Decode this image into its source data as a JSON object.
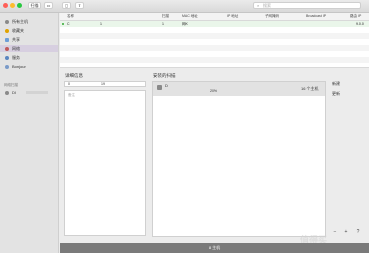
{
  "toolbar": {
    "scan_label": "扫描",
    "search_placeholder": "搜索"
  },
  "sidebar": {
    "items": [
      {
        "label": "所有主机",
        "color": "#8a8a8a"
      },
      {
        "label": "收藏夹",
        "color": "#e0a300"
      },
      {
        "label": "共享",
        "color": "#6c9ed8"
      },
      {
        "label": "网络",
        "color": "#c05a5a"
      },
      {
        "label": "服务",
        "color": "#5a86c0"
      },
      {
        "label": "Bonjour",
        "color": "#7a9ac8"
      }
    ],
    "section_header": "网络扫描",
    "scan_item": {
      "label": "DI"
    }
  },
  "table": {
    "columns": [
      "名称",
      "扫描",
      "MAC 地址",
      "IP 地址",
      "子网掩码",
      "Broadcast IP",
      "路由 IP"
    ],
    "first_row": {
      "name": "C",
      "count": "1",
      "c2": "1",
      "mac": "网K",
      "router": "9.0.0"
    }
  },
  "details": {
    "title": "详细信息",
    "input_value": "0",
    "input_value2": "19",
    "placeholder": "备注"
  },
  "scans": {
    "title": "安装的扫描",
    "row": {
      "name": "D",
      "progress": "20%",
      "result": "16 个主机"
    }
  },
  "side_buttons": [
    "新建",
    "更新"
  ],
  "status": "8 主机",
  "mini_buttons": [
    "−",
    "+",
    "?"
  ],
  "watermark": "值得买"
}
